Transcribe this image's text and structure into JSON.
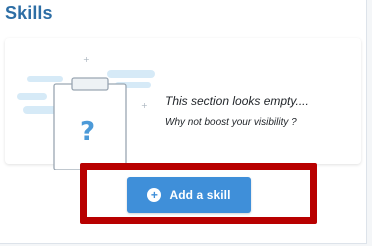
{
  "section": {
    "title": "Skills"
  },
  "empty_state": {
    "message": "This section looks empty....",
    "subtitle": "Why not boost your visibility ?"
  },
  "actions": {
    "add_skill_label": "Add a skill"
  },
  "icons": {
    "illustration": "clipboard-question-icon",
    "add": "plus-circle-icon"
  },
  "colors": {
    "title": "#2d6ea5",
    "button": "#3f8fd9",
    "highlight_border": "#b80000",
    "illustration_cloud": "#d6eaf7",
    "question_mark": "#4c9ad8"
  }
}
